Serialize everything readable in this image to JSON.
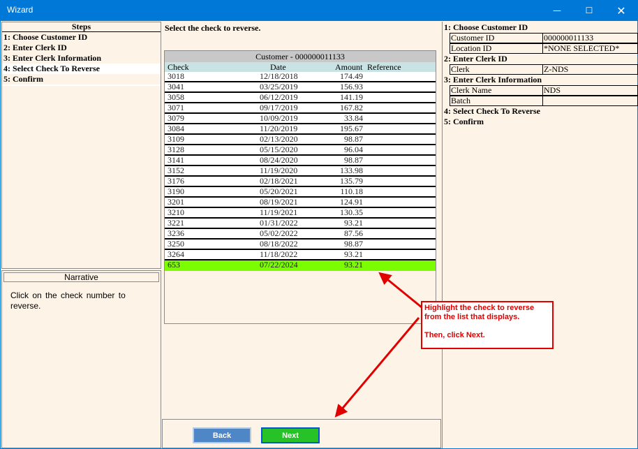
{
  "window": {
    "title": "Wizard",
    "minimize_icon": "minimize-icon",
    "maximize_icon": "maximize-icon",
    "close_icon": "close-icon"
  },
  "steps": {
    "header": "Steps",
    "items": [
      {
        "label": "1: Choose Customer ID"
      },
      {
        "label": "2: Enter Clerk ID"
      },
      {
        "label": "3: Enter Clerk Information"
      },
      {
        "label": "4: Select Check To Reverse"
      },
      {
        "label": "5: Confirm"
      }
    ]
  },
  "narrative": {
    "header": "Narrative",
    "text": "Click on the check number to reverse."
  },
  "main": {
    "instruction": "Select the check to reverse.",
    "grid": {
      "caption": "Customer - 000000011133",
      "columns": [
        "Check",
        "Date",
        "Amount",
        "Reference"
      ],
      "rows": [
        {
          "check": "3018",
          "date": "12/18/2018",
          "amount": "174.49",
          "reference": ""
        },
        {
          "check": "3041",
          "date": "03/25/2019",
          "amount": "156.93",
          "reference": ""
        },
        {
          "check": "3058",
          "date": "06/12/2019",
          "amount": "141.19",
          "reference": ""
        },
        {
          "check": "3071",
          "date": "09/17/2019",
          "amount": "167.82",
          "reference": ""
        },
        {
          "check": "3079",
          "date": "10/09/2019",
          "amount": "33.84",
          "reference": ""
        },
        {
          "check": "3084",
          "date": "11/20/2019",
          "amount": "195.67",
          "reference": ""
        },
        {
          "check": "3109",
          "date": "02/13/2020",
          "amount": "98.87",
          "reference": ""
        },
        {
          "check": "3128",
          "date": "05/15/2020",
          "amount": "96.04",
          "reference": ""
        },
        {
          "check": "3141",
          "date": "08/24/2020",
          "amount": "98.87",
          "reference": ""
        },
        {
          "check": "3152",
          "date": "11/19/2020",
          "amount": "133.98",
          "reference": ""
        },
        {
          "check": "3176",
          "date": "02/18/2021",
          "amount": "135.79",
          "reference": ""
        },
        {
          "check": "3190",
          "date": "05/20/2021",
          "amount": "110.18",
          "reference": ""
        },
        {
          "check": "3201",
          "date": "08/19/2021",
          "amount": "124.91",
          "reference": ""
        },
        {
          "check": "3210",
          "date": "11/19/2021",
          "amount": "130.35",
          "reference": ""
        },
        {
          "check": "3221",
          "date": "01/31/2022",
          "amount": "93.21",
          "reference": ""
        },
        {
          "check": "3236",
          "date": "05/02/2022",
          "amount": "87.56",
          "reference": ""
        },
        {
          "check": "3250",
          "date": "08/18/2022",
          "amount": "98.87",
          "reference": ""
        },
        {
          "check": "3264",
          "date": "11/18/2022",
          "amount": "93.21",
          "reference": ""
        },
        {
          "check": "653",
          "date": "07/22/2024",
          "amount": "93.21",
          "reference": "",
          "selected": true
        }
      ]
    },
    "buttons": {
      "back": "Back",
      "next": "Next"
    }
  },
  "summary": {
    "sections": [
      {
        "heading": "1: Choose Customer ID",
        "fields": [
          {
            "label": "Customer ID",
            "value": "000000011133"
          },
          {
            "label": "Location ID",
            "value": "*NONE SELECTED*"
          }
        ]
      },
      {
        "heading": "2: Enter Clerk ID",
        "fields": [
          {
            "label": "Clerk",
            "value": "Z-NDS"
          }
        ]
      },
      {
        "heading": "3: Enter Clerk Information",
        "fields": [
          {
            "label": "Clerk Name",
            "value": "NDS"
          },
          {
            "label": "Batch",
            "value": ""
          }
        ]
      },
      {
        "heading": "4: Select Check To Reverse",
        "fields": []
      },
      {
        "heading": "5: Confirm",
        "fields": []
      }
    ]
  },
  "callout": {
    "line1": "Highlight the check to reverse from the list that displays.",
    "line2": "Then, click Next."
  },
  "colors": {
    "titlebar": "#0078d7",
    "background": "#fdf3e6",
    "selected_row": "#7cfc00",
    "next_button": "#27c227",
    "back_button": "#4f86c6",
    "callout": "#e00000"
  }
}
